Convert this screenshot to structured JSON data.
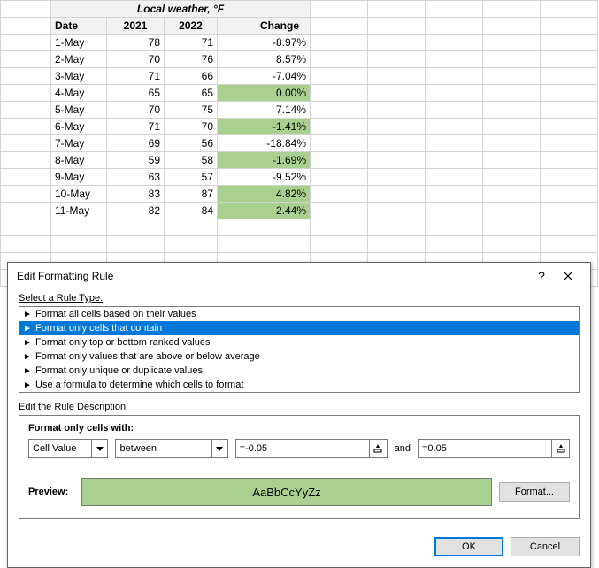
{
  "sheet": {
    "title": "Local weather, °F",
    "headers": {
      "date": "Date",
      "y2021": "2021",
      "y2022": "2022",
      "change": "Change"
    },
    "rows": [
      {
        "date": "1-May",
        "y2021": "78",
        "y2022": "71",
        "change": "-8.97%",
        "hl": false
      },
      {
        "date": "2-May",
        "y2021": "70",
        "y2022": "76",
        "change": "8.57%",
        "hl": false
      },
      {
        "date": "3-May",
        "y2021": "71",
        "y2022": "66",
        "change": "-7.04%",
        "hl": false
      },
      {
        "date": "4-May",
        "y2021": "65",
        "y2022": "65",
        "change": "0.00%",
        "hl": true
      },
      {
        "date": "5-May",
        "y2021": "70",
        "y2022": "75",
        "change": "7.14%",
        "hl": false
      },
      {
        "date": "6-May",
        "y2021": "71",
        "y2022": "70",
        "change": "-1.41%",
        "hl": true
      },
      {
        "date": "7-May",
        "y2021": "69",
        "y2022": "56",
        "change": "-18.84%",
        "hl": false
      },
      {
        "date": "8-May",
        "y2021": "59",
        "y2022": "58",
        "change": "-1.69%",
        "hl": true
      },
      {
        "date": "9-May",
        "y2021": "63",
        "y2022": "57",
        "change": "-9.52%",
        "hl": false
      },
      {
        "date": "10-May",
        "y2021": "83",
        "y2022": "87",
        "change": "4.82%",
        "hl": true
      },
      {
        "date": "11-May",
        "y2021": "82",
        "y2022": "84",
        "change": "2.44%",
        "hl": true
      }
    ],
    "tail_rows": 4
  },
  "dialog": {
    "title": "Edit Formatting Rule",
    "help": "?",
    "rule_type_label": "Select a Rule Type:",
    "rule_types": [
      "Format all cells based on their values",
      "Format only cells that contain",
      "Format only top or bottom ranked values",
      "Format only values that are above or below average",
      "Format only unique or duplicate values",
      "Use a formula to determine which cells to format"
    ],
    "selected_rule_index": 1,
    "desc_label": "Edit the Rule Description:",
    "desc_title": "Format only cells with:",
    "combo1": "Cell Value",
    "combo2": "between",
    "val1": "=-0.05",
    "and": "and",
    "val2": "=0.05",
    "preview_label": "Preview:",
    "preview_text": "AaBbCcYyZz",
    "format_btn": "Format...",
    "ok": "OK",
    "cancel": "Cancel"
  }
}
